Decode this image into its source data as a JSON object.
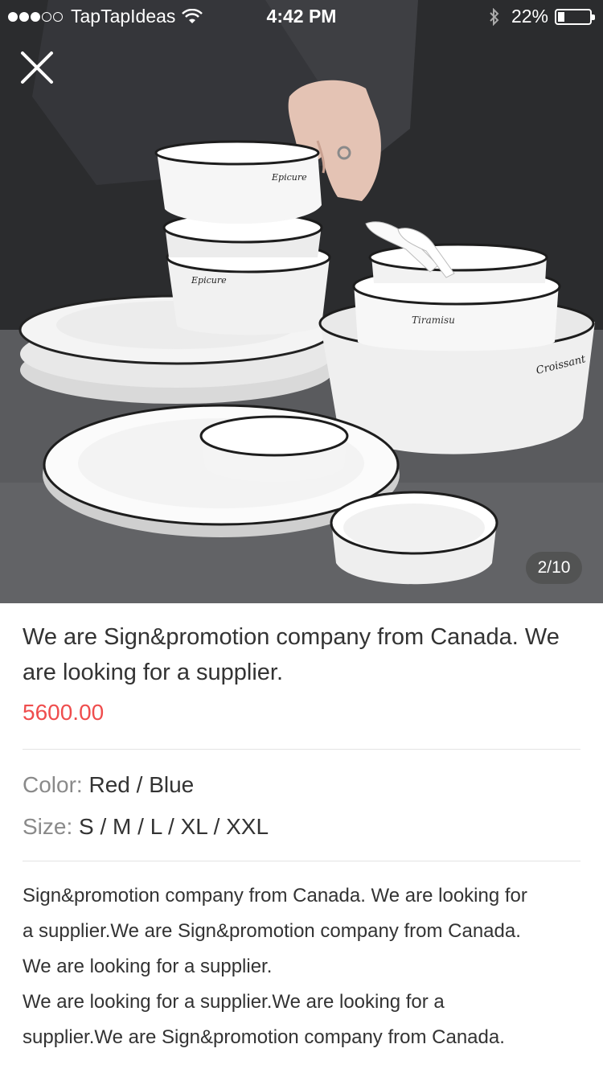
{
  "status_bar": {
    "carrier": "TapTapIdeas",
    "time": "4:42 PM",
    "battery": "22%",
    "battery_level": 0.22
  },
  "gallery": {
    "counter": "2/10",
    "bowl_labels": {
      "top_bowl": "Epicure",
      "middle_bowl": "Epicure",
      "small_bowl": "Tiramisu",
      "large_bowl": "Croissant"
    }
  },
  "product": {
    "title": "We are Sign&promotion company from Canada. We are looking for a supplier.",
    "price": "5600.00",
    "color_label": "Color:",
    "color_value": "Red / Blue",
    "size_label": "Size:",
    "size_value": "S / M / L / XL / XXL",
    "description_lines": [
      "Sign&promotion company from Canada. We are looking for",
      "a supplier.We are Sign&promotion company from Canada.",
      "We are looking for a supplier.",
      "We are looking for a supplier.We are looking for a",
      "supplier.We are Sign&promotion company from Canada."
    ]
  },
  "colors": {
    "price": "#ef4d4d",
    "label": "#8a8a8a",
    "text": "#333333"
  }
}
